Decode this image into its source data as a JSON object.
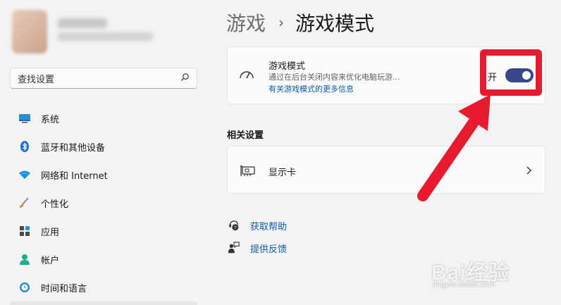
{
  "search": {
    "placeholder": "查找设置"
  },
  "sidebar": {
    "items": [
      {
        "label": "系统",
        "icon": "system-icon"
      },
      {
        "label": "蓝牙和其他设备",
        "icon": "bluetooth-icon"
      },
      {
        "label": "网络和 Internet",
        "icon": "wifi-icon"
      },
      {
        "label": "个性化",
        "icon": "brush-icon"
      },
      {
        "label": "应用",
        "icon": "apps-icon"
      },
      {
        "label": "帐户",
        "icon": "account-icon"
      },
      {
        "label": "时间和语言",
        "icon": "clock-globe-icon"
      }
    ]
  },
  "header": {
    "parent": "游戏",
    "separator": "›",
    "current": "游戏模式"
  },
  "game_mode": {
    "title": "游戏模式",
    "description": "通过在后台关闭内容来优化电脑玩游...",
    "link": "有关游戏模式的更多信息",
    "toggle_label": "开",
    "toggle_on": true
  },
  "related": {
    "title": "相关设置",
    "items": [
      {
        "label": "显示卡"
      }
    ]
  },
  "help": {
    "get_help": "获取帮助",
    "feedback": "提供反馈"
  },
  "watermark": {
    "main": "Bai经验",
    "sub": "jingyan.baidu.com"
  },
  "colors": {
    "accent": "#38478a",
    "link": "#0b5cad",
    "highlight_red": "#e81a2e",
    "background": "#f3f3f3",
    "card": "#fbfbfb"
  }
}
